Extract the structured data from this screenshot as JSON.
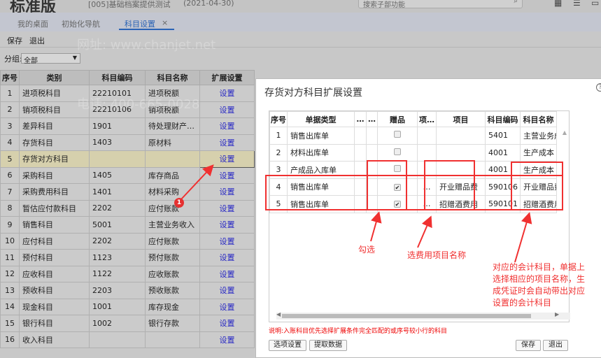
{
  "app": {
    "brand": "标准版",
    "company": "[005]基础档案提供测试",
    "date": "(2021-04-30)",
    "search_placeholder": "搜索子部功能"
  },
  "tabs": [
    {
      "label": "我的桌面"
    },
    {
      "label": "初始化导航"
    },
    {
      "label": "科目设置",
      "close": "×"
    }
  ],
  "toolbar": {
    "save": "保存",
    "exit": "退出"
  },
  "group": {
    "label": "分组:",
    "value": "全部"
  },
  "main_table": {
    "headers": [
      "序号",
      "类别",
      "科目编码",
      "科目名称",
      "扩展设置"
    ],
    "rows": [
      [
        "1",
        "进项税科目",
        "22210101",
        "进项税额",
        "设置"
      ],
      [
        "2",
        "销项税科目",
        "22210106",
        "销项税额",
        "设置"
      ],
      [
        "3",
        "差异科目",
        "1901",
        "待处理财产…",
        "设置"
      ],
      [
        "4",
        "存货科目",
        "1403",
        "原材料",
        "设置"
      ],
      [
        "5",
        "存货对方科目",
        "",
        "",
        "设置"
      ],
      [
        "6",
        "采购科目",
        "1405",
        "库存商品",
        "设置"
      ],
      [
        "7",
        "采购费用科目",
        "1401",
        "材料采购",
        "设置"
      ],
      [
        "8",
        "暂估应付款科目",
        "2202",
        "应付账款",
        "设置"
      ],
      [
        "9",
        "销售科目",
        "5001",
        "主营业务收入",
        "设置"
      ],
      [
        "10",
        "应付科目",
        "2202",
        "应付账款",
        "设置"
      ],
      [
        "11",
        "预付科目",
        "1123",
        "预付账款",
        "设置"
      ],
      [
        "12",
        "应收科目",
        "1122",
        "应收账款",
        "设置"
      ],
      [
        "13",
        "预收科目",
        "2203",
        "预收账款",
        "设置"
      ],
      [
        "14",
        "现金科目",
        "1001",
        "库存现金",
        "设置"
      ],
      [
        "15",
        "银行科目",
        "1002",
        "银行存款",
        "设置"
      ],
      [
        "16",
        "收入科目",
        "",
        "",
        "设置"
      ]
    ]
  },
  "dialog": {
    "title": "存货对方科目扩展设置",
    "help": "?",
    "headers": [
      "序号",
      "单据类型",
      "…",
      "…",
      "赠品",
      "项…",
      "项目",
      "科目编码",
      "科目名称"
    ],
    "rows": [
      {
        "no": "1",
        "type": "销售出库单",
        "gift": false,
        "dots": "",
        "project": "",
        "code": "5401",
        "name": "主营业务成本"
      },
      {
        "no": "2",
        "type": "材料出库单",
        "gift": false,
        "dots": "",
        "project": "",
        "code": "4001",
        "name": "生产成本"
      },
      {
        "no": "3",
        "type": "产成品入库单",
        "gift": false,
        "dots": "",
        "project": "",
        "code": "4001",
        "name": "生产成本"
      },
      {
        "no": "4",
        "type": "销售出库单",
        "gift": true,
        "dots": "…",
        "project": "开业赠品费",
        "code": "590106",
        "name": "开业赠品费"
      },
      {
        "no": "5",
        "type": "销售出库单",
        "gift": true,
        "dots": "…",
        "project": "招赠酒费用",
        "code": "590101",
        "name": "招赠酒费用"
      }
    ],
    "note": "说明:入账科目优先选择扩展条件完全匹配的或序号较小行的科目",
    "buttons": {
      "options": "选项设置",
      "fetch": "提取数据",
      "save": "保存",
      "exit": "退出"
    }
  },
  "annotations": {
    "badge": "1",
    "check": "勾选",
    "project": "选费用项目名称",
    "account": "对应的会计科目，单据上选择相应的项目名称，生成凭证时会自动带出对应设置的会计科目"
  },
  "watermarks": {
    "phone": "电话: 400-665-0028",
    "site": "网址: www.chanjet.net"
  },
  "colors": {
    "accent": "#2a63b5",
    "annotation": "#f03030",
    "link": "#2626c4"
  }
}
